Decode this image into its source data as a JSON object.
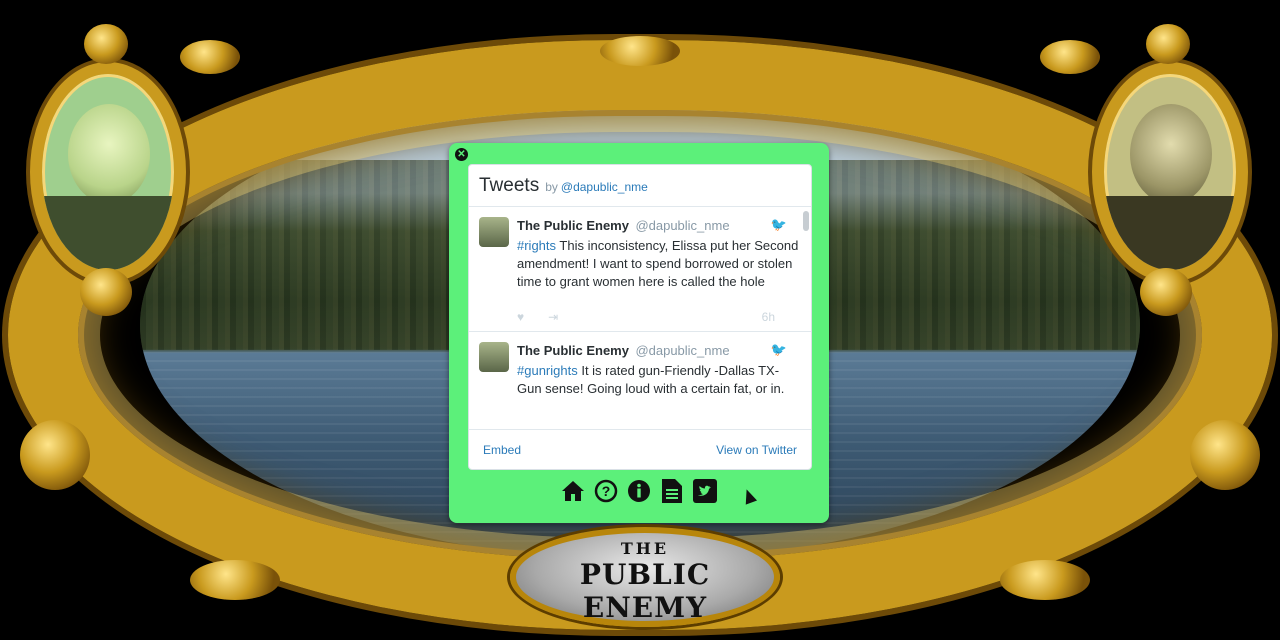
{
  "timeline": {
    "title": "Tweets",
    "by_label": "by",
    "handle": "@dapublic_nme",
    "embed_label": "Embed",
    "view_label": "View on Twitter",
    "tweets": [
      {
        "name": "The Public Enemy",
        "handle": "@dapublic_nme",
        "hashtag": "#rights",
        "text": " This inconsistency, Elissa put her Second amendment! I want to spend borrowed or stolen time to grant women here is called the hole",
        "time": "6h"
      },
      {
        "name": "The Public Enemy",
        "handle": "@dapublic_nme",
        "hashtag": "#gunrights",
        "text": " It is rated gun-Friendly -Dallas TX-Gun sense! Going loud with a certain fat, or in."
      }
    ]
  },
  "icons": {
    "home": "home-icon",
    "help": "help-icon",
    "info": "info-icon",
    "document": "document-icon",
    "twitter": "twitter-icon"
  },
  "logo": {
    "line1": "THE",
    "line2": "PUBLIC ENEMY"
  },
  "colors": {
    "widget_bg": "#5cf07a",
    "frame_gold": "#c99a1e",
    "link_blue": "#2b7bb9"
  }
}
